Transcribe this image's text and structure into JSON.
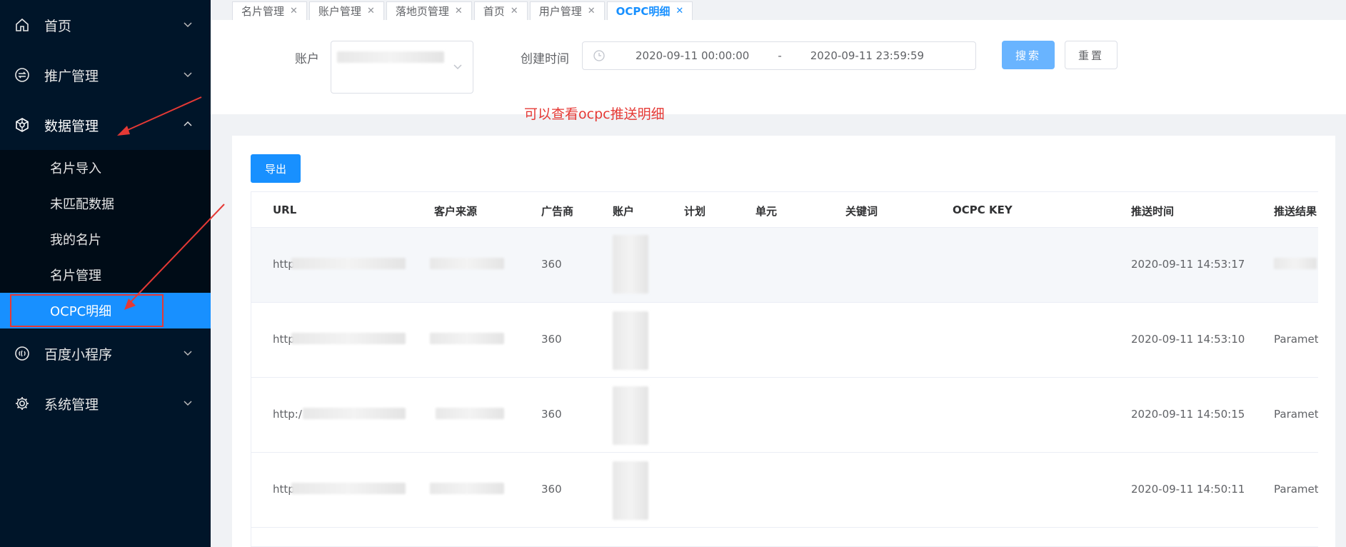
{
  "sidebar": {
    "menu": [
      {
        "label": "首页",
        "icon": "home-icon"
      },
      {
        "label": "推广管理",
        "icon": "promotion-icon"
      },
      {
        "label": "数据管理",
        "icon": "data-icon",
        "expanded": true
      },
      {
        "label": "百度小程序",
        "icon": "mini-program-icon"
      },
      {
        "label": "系统管理",
        "icon": "gear-icon"
      }
    ],
    "submenu": [
      "名片导入",
      "未匹配数据",
      "我的名片",
      "名片管理",
      "OCPC明细"
    ]
  },
  "tabs": [
    {
      "label": "名片管理"
    },
    {
      "label": "账户管理"
    },
    {
      "label": "落地页管理"
    },
    {
      "label": "首页"
    },
    {
      "label": "用户管理"
    },
    {
      "label": "OCPC明细",
      "active": true
    }
  ],
  "filter": {
    "account_label": "账户",
    "time_label": "创建时间",
    "start": "2020-09-11 00:00:00",
    "range_sep": "-",
    "end": "2020-09-11 23:59:59",
    "search_label": "搜索",
    "reset_label": "重置"
  },
  "annotation": "可以查看ocpc推送明细",
  "export_label": "导出",
  "table": {
    "headers": [
      "URL",
      "客户来源",
      "广告商",
      "账户",
      "计划",
      "单元",
      "关键词",
      "OCPC KEY",
      "推送时间",
      "推送结果"
    ],
    "rows": [
      {
        "url": "http",
        "adv": "360",
        "time": "2020-09-11 14:53:17",
        "result": ""
      },
      {
        "url": "http",
        "adv": "360",
        "time": "2020-09-11 14:53:10",
        "result": "Paramet"
      },
      {
        "url": "http:/",
        "adv": "360",
        "time": "2020-09-11 14:50:15",
        "result": "Paramet"
      },
      {
        "url": "http",
        "adv": "360",
        "time": "2020-09-11 14:50:11",
        "result": "Paramet"
      }
    ]
  },
  "colors": {
    "sidebar_bg": "#001529",
    "accent": "#1890ff",
    "annotation": "#e53935"
  }
}
